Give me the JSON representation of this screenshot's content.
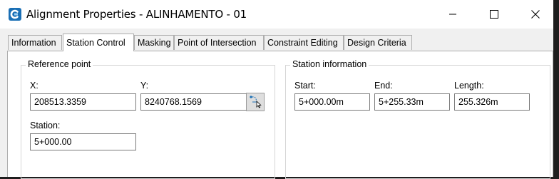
{
  "window": {
    "title": "Alignment Properties - ALINHAMENTO - 01",
    "icon": "civil-app-icon",
    "controls": [
      "minimize-icon",
      "maximize-icon",
      "close-icon"
    ]
  },
  "tabs": [
    {
      "label": "Information",
      "active": false
    },
    {
      "label": "Station Control",
      "active": true
    },
    {
      "label": "Masking",
      "active": false
    },
    {
      "label": "Point of Intersection",
      "active": false
    },
    {
      "label": "Constraint Editing",
      "active": false
    },
    {
      "label": "Design Criteria",
      "active": false
    }
  ],
  "reference_point": {
    "legend": "Reference point",
    "x_label": "X:",
    "x_value": "208513.3359",
    "y_label": "Y:",
    "y_value": "8240768.1569",
    "station_label": "Station:",
    "station_value": "5+000.00",
    "pick_button_icon": "pick-point-icon"
  },
  "station_information": {
    "legend": "Station information",
    "start_label": "Start:",
    "start_value": "5+000.00m",
    "end_label": "End:",
    "end_value": "5+255.33m",
    "length_label": "Length:",
    "length_value": "255.326m"
  },
  "colors": {
    "app_icon_blue": "#1a6fb5",
    "window_bg": "#f0f0f0",
    "panel_bg": "#ffffff",
    "border": "#adadad"
  }
}
